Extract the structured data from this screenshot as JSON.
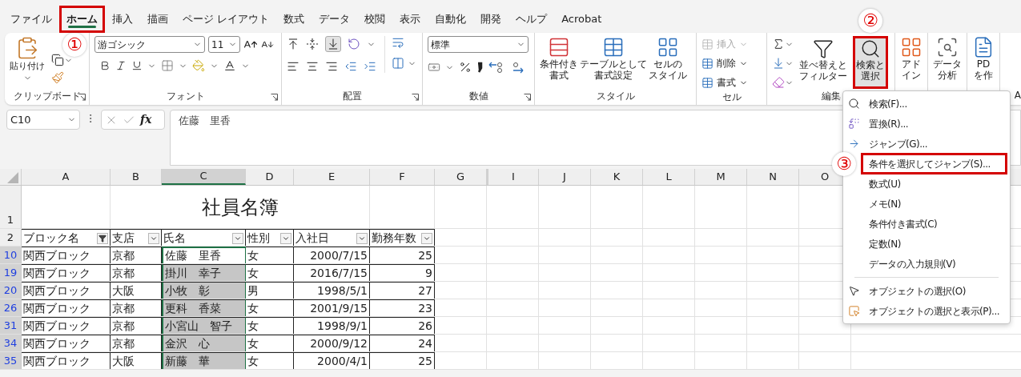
{
  "tabs": [
    {
      "label": "ファイル",
      "selected": false
    },
    {
      "label": "ホーム",
      "selected": true,
      "callout": "①"
    },
    {
      "label": "挿入",
      "selected": false
    },
    {
      "label": "描画",
      "selected": false
    },
    {
      "label": "ページ レイアウト",
      "selected": false
    },
    {
      "label": "数式",
      "selected": false
    },
    {
      "label": "データ",
      "selected": false
    },
    {
      "label": "校閲",
      "selected": false
    },
    {
      "label": "表示",
      "selected": false
    },
    {
      "label": "自動化",
      "selected": false
    },
    {
      "label": "開発",
      "selected": false
    },
    {
      "label": "ヘルプ",
      "selected": false
    },
    {
      "label": "Acrobat",
      "selected": false
    }
  ],
  "ribbon": {
    "clipboard": {
      "label": "クリップボード",
      "paste": "貼り付け"
    },
    "font": {
      "label": "フォント",
      "font_name": "游ゴシック",
      "font_size": "11"
    },
    "alignment": {
      "label": "配置"
    },
    "number": {
      "label": "数値",
      "format": "標準"
    },
    "styles": {
      "label": "スタイル",
      "buttons": [
        {
          "lines": [
            "条件付き",
            "書式"
          ]
        },
        {
          "lines": [
            "テーブルとして",
            "書式設定"
          ]
        },
        {
          "lines": [
            "セルの",
            "スタイル"
          ]
        }
      ]
    },
    "cells": {
      "label": "セル",
      "buttons": [
        {
          "label": "挿入",
          "disabled": true
        },
        {
          "label": "削除",
          "disabled": false
        },
        {
          "label": "書式",
          "disabled": false
        }
      ]
    },
    "editing": {
      "label": "編集",
      "buttons": [
        {
          "lines": [
            "並べ替えと",
            "フィルター"
          ],
          "pressed": false
        },
        {
          "lines": [
            "検索と",
            "選択"
          ],
          "pressed": true,
          "callout": "②"
        }
      ]
    },
    "extra": [
      {
        "lines": [
          "アド",
          "イン"
        ]
      },
      {
        "lines": [
          "データ",
          "分析"
        ]
      },
      {
        "lines": [
          "PD",
          "を作"
        ]
      }
    ],
    "cut_group_label": "A"
  },
  "formula_bar": {
    "name_box": "C10",
    "function_label": "fx",
    "value": "佐藤　里香"
  },
  "table": {
    "columns": [
      {
        "label": "A",
        "selected": false
      },
      {
        "label": "B",
        "selected": false
      },
      {
        "label": "C",
        "selected": true
      },
      {
        "label": "D",
        "selected": false
      },
      {
        "label": "E",
        "selected": false
      },
      {
        "label": "F",
        "selected": false
      },
      {
        "label": "G",
        "selected": false
      },
      {
        "label": "I",
        "selected": false
      },
      {
        "label": "J",
        "selected": false
      },
      {
        "label": "K",
        "selected": false
      },
      {
        "label": "L",
        "selected": false
      },
      {
        "label": "M",
        "selected": false
      },
      {
        "label": "N",
        "selected": false
      },
      {
        "label": "O",
        "selected": false
      }
    ],
    "rows": [
      {
        "number": "1",
        "kind": "title",
        "title": "社員名簿",
        "filtered": false,
        "selected": false
      },
      {
        "number": "2",
        "kind": "header",
        "filtered": false,
        "selected": false,
        "cells": [
          {
            "text": "ブロック名",
            "filter_applied": true
          },
          {
            "text": "支店",
            "filter_applied": false
          },
          {
            "text": "氏名",
            "filter_applied": false
          },
          {
            "text": "性別",
            "filter_applied": false
          },
          {
            "text": "入社日",
            "filter_applied": false
          },
          {
            "text": "勤務年数",
            "filter_applied": false
          }
        ]
      },
      {
        "number": "10",
        "kind": "data",
        "filtered": true,
        "selected": true,
        "active": true,
        "cells": [
          "関西ブロック",
          "京都",
          "佐藤　里香",
          "女",
          "2000/7/15",
          "25"
        ]
      },
      {
        "number": "19",
        "kind": "data",
        "filtered": true,
        "selected": true,
        "active": false,
        "cells": [
          "関西ブロック",
          "京都",
          "掛川　幸子",
          "女",
          "2016/7/15",
          "9"
        ]
      },
      {
        "number": "20",
        "kind": "data",
        "filtered": true,
        "selected": true,
        "active": false,
        "cells": [
          "関西ブロック",
          "大阪",
          "小牧　彰",
          "男",
          "1998/5/1",
          "27"
        ]
      },
      {
        "number": "26",
        "kind": "data",
        "filtered": true,
        "selected": true,
        "active": false,
        "cells": [
          "関西ブロック",
          "京都",
          "更科　香菜",
          "女",
          "2001/9/15",
          "23"
        ]
      },
      {
        "number": "31",
        "kind": "data",
        "filtered": true,
        "selected": true,
        "active": false,
        "cells": [
          "関西ブロック",
          "京都",
          "小宮山　智子",
          "女",
          "1998/9/1",
          "26"
        ]
      },
      {
        "number": "34",
        "kind": "data",
        "filtered": true,
        "selected": true,
        "active": false,
        "cells": [
          "関西ブロック",
          "京都",
          "金沢　心",
          "女",
          "2000/9/12",
          "24"
        ]
      },
      {
        "number": "35",
        "kind": "data",
        "filtered": true,
        "selected": true,
        "active": false,
        "cells": [
          "関西ブロック",
          "大阪",
          "新藤　華",
          "女",
          "2000/4/1",
          "25"
        ]
      }
    ]
  },
  "menu": {
    "items": [
      {
        "kind": "find",
        "label": "検索(F)..."
      },
      {
        "kind": "replace",
        "label": "置換(R)..."
      },
      {
        "kind": "jump",
        "label": "ジャンプ(G)..."
      },
      {
        "kind": "text",
        "label": "条件を選択してジャンプ(S)...",
        "callout": "③"
      },
      {
        "kind": "text",
        "label": "数式(U)"
      },
      {
        "kind": "text",
        "label": "メモ(N)"
      },
      {
        "kind": "text",
        "label": "条件付き書式(C)"
      },
      {
        "kind": "text",
        "label": "定数(N)"
      },
      {
        "kind": "text",
        "label": "データの入力規則(V)"
      },
      {
        "kind": "separator"
      },
      {
        "kind": "pointer",
        "label": "オブジェクトの選択(O)"
      },
      {
        "kind": "pane",
        "label": "オブジェクトの選択と表示(P)..."
      }
    ]
  }
}
